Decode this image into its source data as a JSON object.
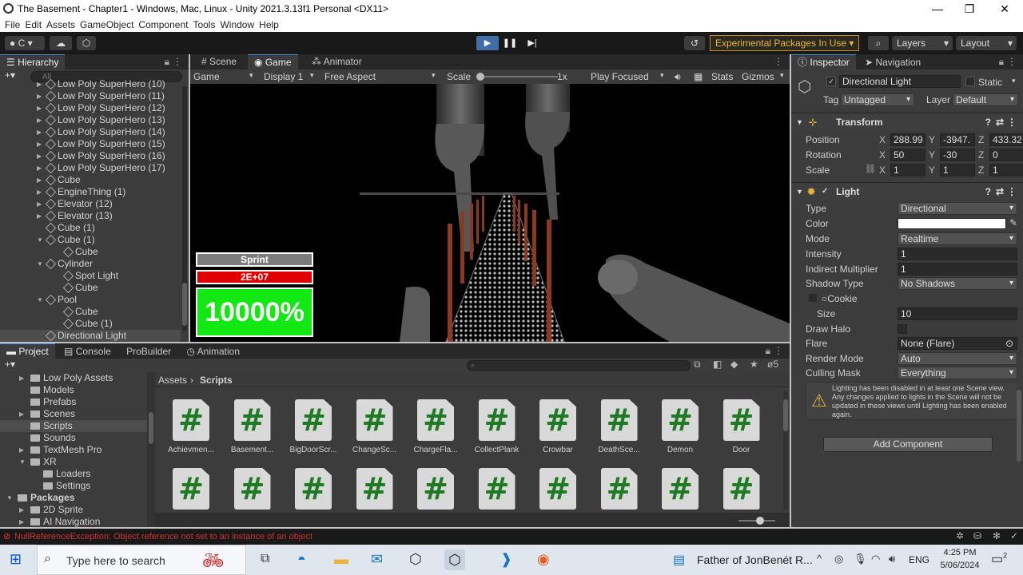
{
  "window": {
    "title": "The Basement - Chapter1 - Windows, Mac, Linux - Unity 2021.3.13f1 Personal <DX11>"
  },
  "menu": [
    "File",
    "Edit",
    "Assets",
    "GameObject",
    "Component",
    "Tools",
    "Window",
    "Help"
  ],
  "toolbar": {
    "account": "C",
    "experimental": "Experimental Packages In Use",
    "layers": "Layers",
    "layout": "Layout"
  },
  "hierarchy": {
    "tab": "Hierarchy",
    "search_placeholder": "All",
    "rows": [
      {
        "label": "Low Poly SuperHero (10)",
        "indent": 1,
        "arrow": true
      },
      {
        "label": "Low Poly SuperHero (11)",
        "indent": 1,
        "arrow": true
      },
      {
        "label": "Low Poly SuperHero (12)",
        "indent": 1,
        "arrow": true
      },
      {
        "label": "Low Poly SuperHero (13)",
        "indent": 1,
        "arrow": true
      },
      {
        "label": "Low Poly SuperHero (14)",
        "indent": 1,
        "arrow": true
      },
      {
        "label": "Low Poly SuperHero (15)",
        "indent": 1,
        "arrow": true
      },
      {
        "label": "Low Poly SuperHero (16)",
        "indent": 1,
        "arrow": true
      },
      {
        "label": "Low Poly SuperHero (17)",
        "indent": 1,
        "arrow": true
      },
      {
        "label": "Cube",
        "indent": 1,
        "arrow": true
      },
      {
        "label": "EngineThing (1)",
        "indent": 1,
        "arrow": true
      },
      {
        "label": "Elevator (12)",
        "indent": 1,
        "arrow": true
      },
      {
        "label": "Elevator (13)",
        "indent": 1,
        "arrow": true
      },
      {
        "label": "Cube (1)",
        "indent": 1,
        "arrow": false
      },
      {
        "label": "Cube (1)",
        "indent": 1,
        "arrow": "open"
      },
      {
        "label": "Cube",
        "indent": 2,
        "arrow": false
      },
      {
        "label": "Cylinder",
        "indent": 1,
        "arrow": "open"
      },
      {
        "label": "Spot Light",
        "indent": 2,
        "arrow": false
      },
      {
        "label": "Cube",
        "indent": 2,
        "arrow": false
      },
      {
        "label": "Pool",
        "indent": 1,
        "arrow": "open"
      },
      {
        "label": "Cube",
        "indent": 2,
        "arrow": false
      },
      {
        "label": "Cube (1)",
        "indent": 2,
        "arrow": false
      },
      {
        "label": "Directional Light",
        "indent": 1,
        "arrow": false,
        "selected": true
      }
    ]
  },
  "gameview": {
    "tabs": [
      "Scene",
      "Game",
      "Animator"
    ],
    "display_mode": "Game",
    "display": "Display 1",
    "aspect": "Free Aspect",
    "scale_label": "Scale",
    "scale_value": "1x",
    "play_focused": "Play Focused",
    "stats": "Stats",
    "gizmos": "Gizmos",
    "hud": {
      "sprint": "Sprint",
      "health": "2E+07",
      "percent": "10000%"
    }
  },
  "inspector": {
    "tabs": [
      "Inspector",
      "Navigation"
    ],
    "object_name": "Directional Light",
    "static": "Static",
    "tag_label": "Tag",
    "tag": "Untagged",
    "layer_label": "Layer",
    "layer": "Default",
    "transform": {
      "title": "Transform",
      "position": {
        "label": "Position",
        "x": "288.99",
        "y": "-3947.",
        "z": "433.32"
      },
      "rotation": {
        "label": "Rotation",
        "x": "50",
        "y": "-30",
        "z": "0"
      },
      "scale": {
        "label": "Scale",
        "x": "1",
        "y": "1",
        "z": "1"
      }
    },
    "light": {
      "title": "Light",
      "type_label": "Type",
      "type": "Directional",
      "color_label": "Color",
      "color": "#ffffff",
      "mode_label": "Mode",
      "mode": "Realtime",
      "intensity_label": "Intensity",
      "intensity": "1",
      "indirect_label": "Indirect Multiplier",
      "indirect": "1",
      "shadow_label": "Shadow Type",
      "shadow": "No Shadows",
      "cookie_label": "Cookie",
      "size_label": "Size",
      "size": "10",
      "halo_label": "Draw Halo",
      "flare_label": "Flare",
      "flare": "None (Flare)",
      "render_label": "Render Mode",
      "render": "Auto",
      "culling_label": "Culling Mask",
      "culling": "Everything",
      "warning": "Lighting has been disabled in at least one Scene view. Any changes applied to lights in the Scene will not be updated in these views until Lighting has been enabled again."
    },
    "add_component": "Add Component"
  },
  "project": {
    "tabs": [
      "Project",
      "Console",
      "ProBuilder",
      "Animation"
    ],
    "breadcrumb_root": "Assets",
    "breadcrumb_current": "Scripts",
    "count": "5",
    "tree": [
      {
        "label": "Low Poly Assets",
        "indent": 1,
        "arrow": true
      },
      {
        "label": "Models",
        "indent": 1,
        "arrow": false
      },
      {
        "label": "Prefabs",
        "indent": 1,
        "arrow": false
      },
      {
        "label": "Scenes",
        "indent": 1,
        "arrow": true
      },
      {
        "label": "Scripts",
        "indent": 1,
        "arrow": false,
        "selected": true
      },
      {
        "label": "Sounds",
        "indent": 1,
        "arrow": false
      },
      {
        "label": "TextMesh Pro",
        "indent": 1,
        "arrow": true
      },
      {
        "label": "XR",
        "indent": 1,
        "arrow": "open"
      },
      {
        "label": "Loaders",
        "indent": 2,
        "arrow": false
      },
      {
        "label": "Settings",
        "indent": 2,
        "arrow": false
      },
      {
        "label": "Packages",
        "indent": 0,
        "arrow": "open",
        "bold": true
      },
      {
        "label": "2D Sprite",
        "indent": 1,
        "arrow": true
      },
      {
        "label": "AI Navigation",
        "indent": 1,
        "arrow": true
      }
    ],
    "scripts_row1": [
      "Achievmen...",
      "Basement...",
      "BigDoorScr...",
      "ChangeSc...",
      "ChargeFla...",
      "CollectPlank",
      "Crowbar",
      "DeathSce...",
      "Demon",
      "Door"
    ],
    "scripts_row2": [
      "",
      "",
      "",
      "",
      "",
      "",
      "",
      "",
      "",
      ""
    ]
  },
  "status": {
    "error": "NullReferenceException: Object reference not set to an instance of an object"
  },
  "taskbar": {
    "search": "Type here to search",
    "news": "Father of JonBenét R...",
    "lang": "ENG",
    "time": "4:25 PM",
    "date": "5/06/2024",
    "notif": "2"
  }
}
